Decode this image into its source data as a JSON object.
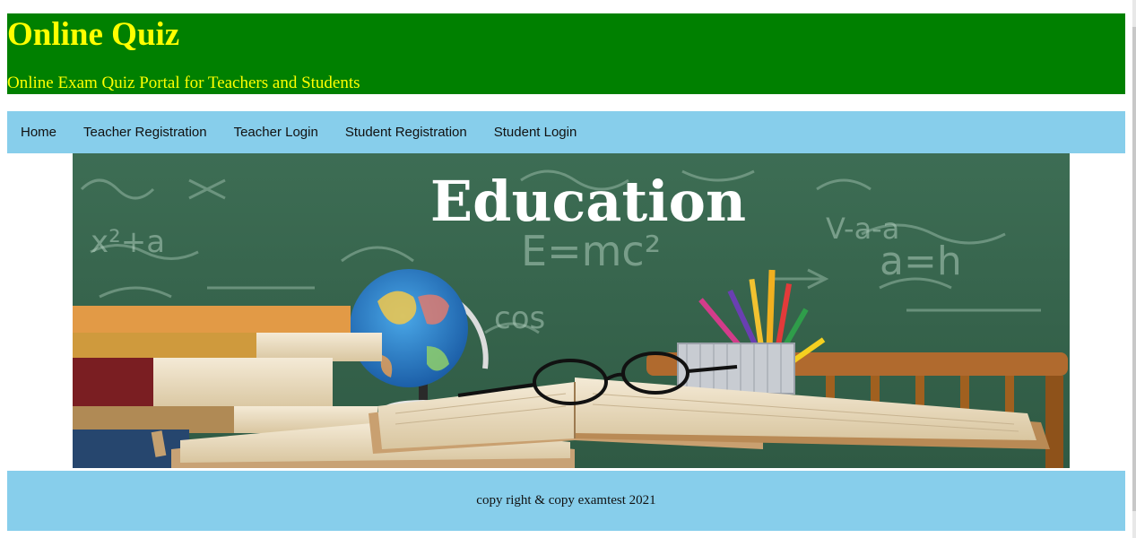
{
  "header": {
    "title": "Online Quiz",
    "subtitle": "Online Exam Quiz Portal for Teachers and Students"
  },
  "nav": {
    "items": [
      {
        "label": "Home"
      },
      {
        "label": "Teacher Registration"
      },
      {
        "label": "Teacher Login"
      },
      {
        "label": "Student Registration"
      },
      {
        "label": "Student Login"
      }
    ]
  },
  "banner": {
    "heading": "Education",
    "chalkboard_text": [
      "E=mc²",
      "a=h",
      "x²+a",
      "cos",
      "V-a-a"
    ]
  },
  "footer": {
    "text": "copy right & copy examtest 2021"
  },
  "colors": {
    "header_bg": "#008000",
    "header_text": "#ffff00",
    "nav_bg": "#87ceeb",
    "footer_bg": "#87ceeb"
  }
}
